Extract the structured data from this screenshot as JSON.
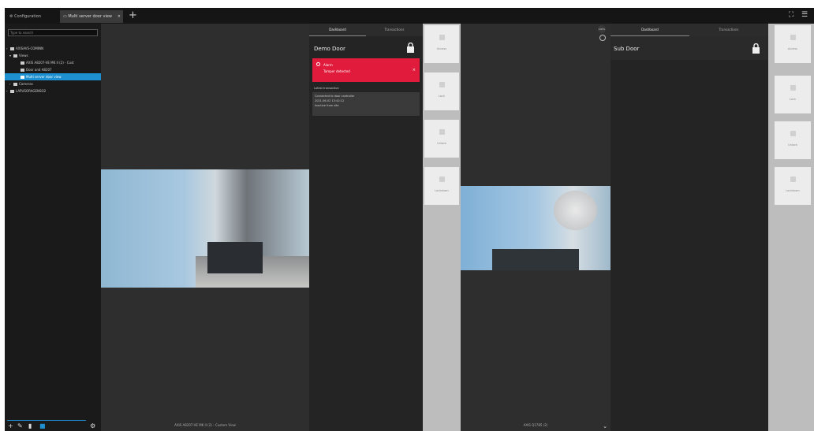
{
  "topbar": {
    "tabs": [
      {
        "label": "Configuration"
      },
      {
        "label": "Multi server door view",
        "close": "×"
      }
    ],
    "add_tab": "+"
  },
  "sidebar": {
    "search_placeholder": "Type to search",
    "tree": [
      {
        "label": "AXISAVS-COMINN"
      },
      {
        "label": "Views"
      },
      {
        "label": "AXIS A8207-VE MK II (2) - Cust"
      },
      {
        "label": "Door and A8207"
      },
      {
        "label": "Multi server door view"
      },
      {
        "label": "Cameras"
      },
      {
        "label": "LAPUSORAGENSO2"
      }
    ]
  },
  "camera_left": {
    "caption": "AXIS A8207-VE MK II (2) - Custom View"
  },
  "door_panel_left": {
    "tabs": [
      "Dashboard",
      "Transactions"
    ],
    "title": "Demo Door",
    "alarm": {
      "title": "Alarm",
      "message": "Tamper detected",
      "close": "×"
    },
    "events_label": "Latest transaction",
    "events": [
      "Connected to door controller",
      "2021-06-02 13:42:12",
      "Inactive from site"
    ]
  },
  "actions_left": [
    {
      "label": "Access"
    },
    {
      "label": "Lock"
    },
    {
      "label": "Unlock"
    },
    {
      "label": "Lockdown"
    }
  ],
  "camera_right": {
    "caption": "AXIS Q1785 (2)",
    "zoom": "100%"
  },
  "door_panel_right": {
    "tabs": [
      "Dashboard",
      "Transactions"
    ],
    "title": "Sub Door"
  },
  "actions_right": [
    {
      "label": "Access"
    },
    {
      "label": "Lock"
    },
    {
      "label": "Unlock"
    },
    {
      "label": "Lockdown"
    }
  ],
  "colors": {
    "accent": "#1e8fd0",
    "alarm": "#e01b3b"
  }
}
